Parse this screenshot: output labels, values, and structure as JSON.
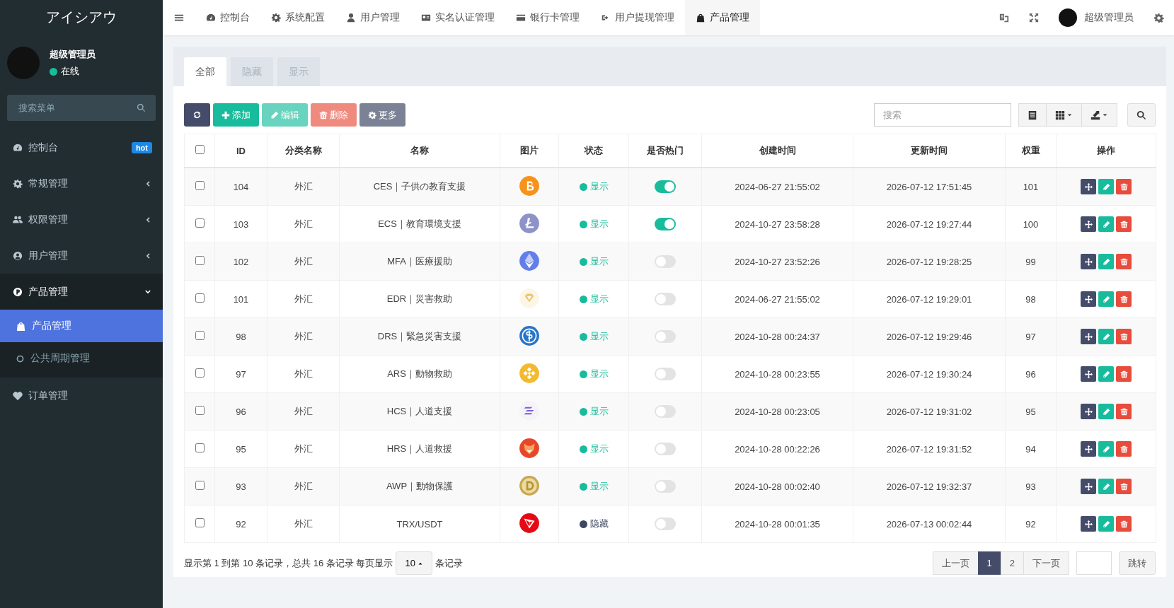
{
  "sidebar": {
    "logo": "アイシアウ",
    "user": {
      "name": "超级管理员",
      "status": "在线"
    },
    "search": {
      "placeholder": "搜索菜单"
    },
    "menu": [
      {
        "label": "控制台",
        "kind": "link",
        "badge": "hot",
        "expanded": false
      },
      {
        "label": "常规管理",
        "kind": "group",
        "expanded": false
      },
      {
        "label": "权限管理",
        "kind": "group",
        "expanded": false
      },
      {
        "label": "用户管理",
        "kind": "group",
        "expanded": false
      },
      {
        "label": "产品管理",
        "kind": "group",
        "expanded": true,
        "children": [
          {
            "label": "产品管理",
            "selected": true
          },
          {
            "label": "公共周期管理",
            "selected": false
          }
        ]
      },
      {
        "label": "订单管理",
        "kind": "link",
        "expanded": false
      }
    ]
  },
  "top_nav": {
    "items": [
      {
        "label": "控制台",
        "selected": false
      },
      {
        "label": "系统配置",
        "selected": false
      },
      {
        "label": "用户管理",
        "selected": false
      },
      {
        "label": "实名认证管理",
        "selected": false
      },
      {
        "label": "银行卡管理",
        "selected": false
      },
      {
        "label": "用户提现管理",
        "selected": false
      },
      {
        "label": "产品管理",
        "selected": true
      }
    ],
    "user": "超级管理员"
  },
  "tabs": [
    {
      "label": "全部",
      "selected": true
    },
    {
      "label": "隐藏",
      "selected": false
    },
    {
      "label": "显示",
      "selected": false
    }
  ],
  "toolbar": {
    "buttons": [
      {
        "label": "添加",
        "disabled": false
      },
      {
        "label": "编辑",
        "disabled": true
      },
      {
        "label": "删除",
        "disabled": true
      },
      {
        "label": "更多",
        "disabled": false
      }
    ],
    "search": {
      "placeholder": "搜索"
    }
  },
  "table": {
    "select_all": {
      "checked": false
    },
    "columns": [
      "ID",
      "分类名称",
      "名称",
      "图片",
      "状态",
      "是否热门",
      "创建时间",
      "更新时间",
      "权重",
      "操作"
    ],
    "rows": [
      {
        "checked": false,
        "id": "104",
        "category": "外汇",
        "name": "CES｜子供の教育支援",
        "status": "显示",
        "color": "#18bc9c",
        "hot": true,
        "created": "2024-06-27 21:55:02",
        "updated": "2026-07-12 17:51:45",
        "weight": "101"
      },
      {
        "checked": false,
        "id": "103",
        "category": "外汇",
        "name": "ECS｜教育環境支援",
        "status": "显示",
        "color": "#18bc9c",
        "hot": true,
        "created": "2024-10-27 23:58:28",
        "updated": "2026-07-12 19:27:44",
        "weight": "100"
      },
      {
        "checked": false,
        "id": "102",
        "category": "外汇",
        "name": "MFA｜医療援助",
        "status": "显示",
        "color": "#18bc9c",
        "hot": false,
        "created": "2024-10-27 23:52:26",
        "updated": "2026-07-12 19:28:25",
        "weight": "99"
      },
      {
        "checked": false,
        "id": "101",
        "category": "外汇",
        "name": "EDR｜災害救助",
        "status": "显示",
        "color": "#18bc9c",
        "hot": false,
        "created": "2024-06-27 21:55:02",
        "updated": "2026-07-12 19:29:01",
        "weight": "98"
      },
      {
        "checked": false,
        "id": "98",
        "category": "外汇",
        "name": "DRS｜緊急災害支援",
        "status": "显示",
        "color": "#18bc9c",
        "hot": false,
        "created": "2024-10-28 00:24:37",
        "updated": "2026-07-12 19:29:46",
        "weight": "97"
      },
      {
        "checked": false,
        "id": "97",
        "category": "外汇",
        "name": "ARS｜動物救助",
        "status": "显示",
        "color": "#18bc9c",
        "hot": false,
        "created": "2024-10-28 00:23:55",
        "updated": "2026-07-12 19:30:24",
        "weight": "96"
      },
      {
        "checked": false,
        "id": "96",
        "category": "外汇",
        "name": "HCS｜人道支援",
        "status": "显示",
        "color": "#18bc9c",
        "hot": false,
        "created": "2024-10-28 00:23:05",
        "updated": "2026-07-12 19:31:02",
        "weight": "95"
      },
      {
        "checked": false,
        "id": "95",
        "category": "外汇",
        "name": "HRS｜人道救援",
        "status": "显示",
        "color": "#18bc9c",
        "hot": false,
        "created": "2024-10-28 00:22:26",
        "updated": "2026-07-12 19:31:52",
        "weight": "94"
      },
      {
        "checked": false,
        "id": "93",
        "category": "外汇",
        "name": "AWP｜動物保護",
        "status": "显示",
        "color": "#18bc9c",
        "hot": false,
        "created": "2024-10-28 00:02:40",
        "updated": "2026-07-12 19:32:37",
        "weight": "93"
      },
      {
        "checked": false,
        "id": "92",
        "category": "外汇",
        "name": "TRX/USDT",
        "status": "隐藏",
        "color": "#3c4762",
        "hot": false,
        "created": "2024-10-28 00:01:35",
        "updated": "2026-07-13 00:02:44",
        "weight": "92"
      }
    ]
  },
  "pagination": {
    "summary": "显示第 1 到第 10 条记录，总共 16 条记录 每页显示",
    "page_size": "10",
    "suffix": "条记录",
    "prev": "上一页",
    "pages": [
      {
        "label": "1",
        "selected": true
      },
      {
        "label": "2",
        "selected": false
      }
    ],
    "next": "下一页",
    "jump": "跳转"
  }
}
